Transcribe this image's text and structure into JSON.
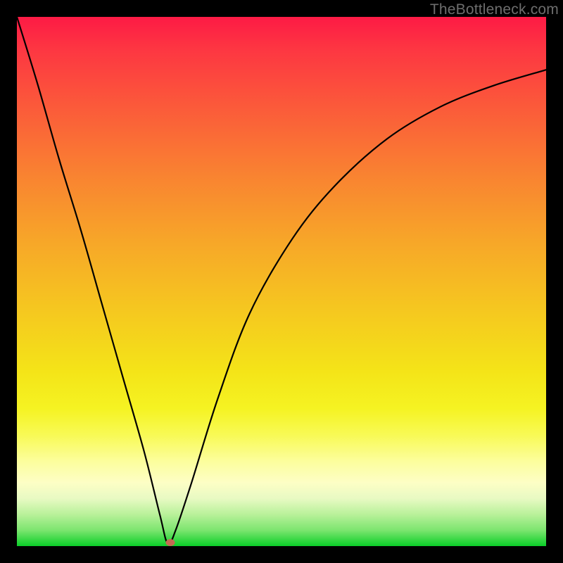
{
  "watermark": "TheBottleneck.com",
  "chart_data": {
    "type": "line",
    "title": "",
    "xlabel": "",
    "ylabel": "",
    "xlim": [
      0,
      100
    ],
    "ylim": [
      0,
      100
    ],
    "series": [
      {
        "name": "bottleneck-curve",
        "x": [
          0,
          4,
          8,
          12,
          16,
          20,
          24,
          27,
          28.5,
          30,
          33,
          38,
          44,
          52,
          60,
          70,
          80,
          90,
          100
        ],
        "y": [
          100,
          87,
          73,
          60,
          46,
          32,
          18,
          6,
          0.5,
          3,
          12,
          28,
          44,
          58,
          68,
          77,
          83,
          87,
          90
        ]
      }
    ],
    "marker": {
      "x": 29.0,
      "y": 0.7
    },
    "background": {
      "top_color": "#fd1a45",
      "bottom_color": "#0bce28"
    }
  }
}
